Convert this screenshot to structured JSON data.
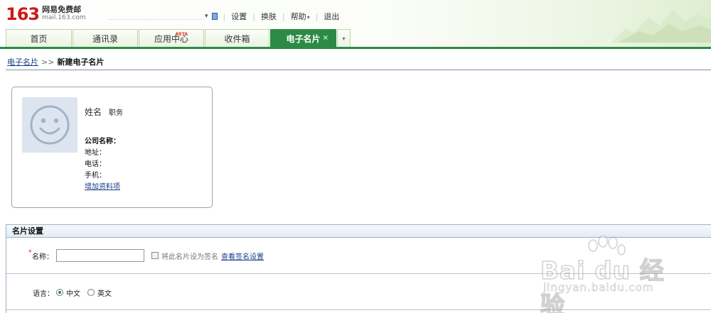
{
  "header": {
    "logo_number": "163",
    "logo_name": "网易免费邮",
    "logo_domain": "mail.163.com",
    "user_caret": "▾",
    "links": {
      "settings": "设置",
      "skin": "换肤",
      "help": "帮助",
      "help_caret": "▾",
      "logout": "退出"
    }
  },
  "tabs": {
    "items": [
      {
        "label": "首页"
      },
      {
        "label": "通讯录"
      },
      {
        "label": "应用中心",
        "badge": "BETA"
      },
      {
        "label": "收件箱"
      },
      {
        "label": "电子名片",
        "close": "×"
      }
    ],
    "more": "▾",
    "active_color": "#2d8a45"
  },
  "breadcrumb": {
    "parent": "电子名片",
    "separator": ">>",
    "current": "新建电子名片"
  },
  "card": {
    "avatar_icon": "smiley-face-icon",
    "name": "姓名",
    "title": "职务",
    "company": "公司名称：",
    "address": "地址：",
    "phone": "电话：",
    "mobile": "手机：",
    "add_link": "增加资料项"
  },
  "settings": {
    "heading": "名片设置",
    "required_mark": "*",
    "name_label": "名称：",
    "name_value": "",
    "signature_checkbox_label": "将此名片设为签名",
    "signature_checked": false,
    "signature_link": "查看签名设置",
    "language_label": "语言：",
    "languages": [
      {
        "label": "中文",
        "selected": true
      },
      {
        "label": "英文",
        "selected": false
      }
    ]
  },
  "watermark": {
    "brand": "Bai du 经验",
    "url": "jingyan.baidu.com"
  }
}
